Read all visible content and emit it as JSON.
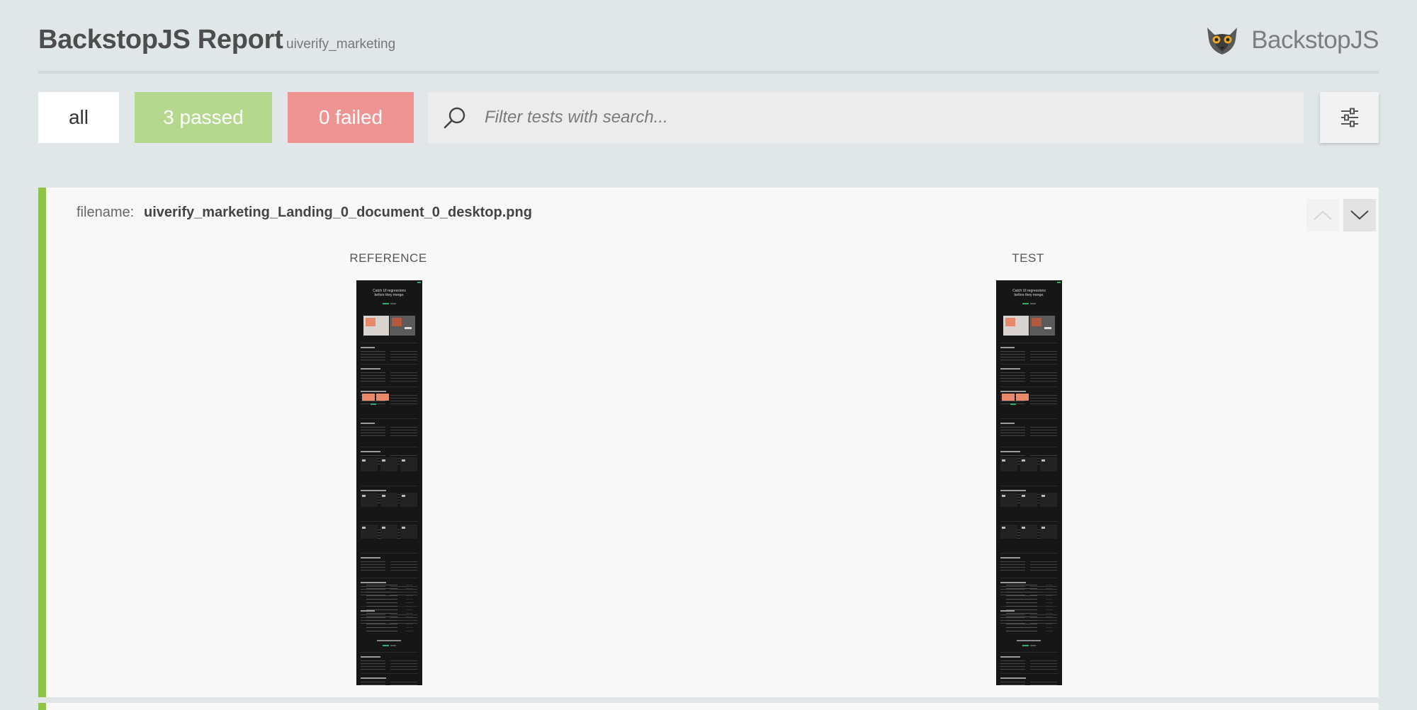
{
  "header": {
    "title": "BackstopJS Report",
    "subtitle": "uiverify_marketing",
    "brand": "BackstopJS",
    "brand_icon": "lemur-logo-icon"
  },
  "filters": {
    "all_label": "all",
    "passed_label": "3 passed",
    "failed_label": "0 failed",
    "search_placeholder": "Filter tests with search...",
    "search_value": ""
  },
  "colors": {
    "background": "#e1e6e9",
    "passed": "#b5d88f",
    "failed": "#ee9594",
    "pass_stripe": "#8ec449"
  },
  "test_card": {
    "filename_label": "filename:",
    "filename": "uiverify_marketing_Landing_0_document_0_desktop.png",
    "reference_label": "REFERENCE",
    "test_label": "TEST",
    "status": "passed"
  },
  "thumbnail": {
    "hero_line1": "Catch UI regressions",
    "hero_line2": "before they merge."
  }
}
